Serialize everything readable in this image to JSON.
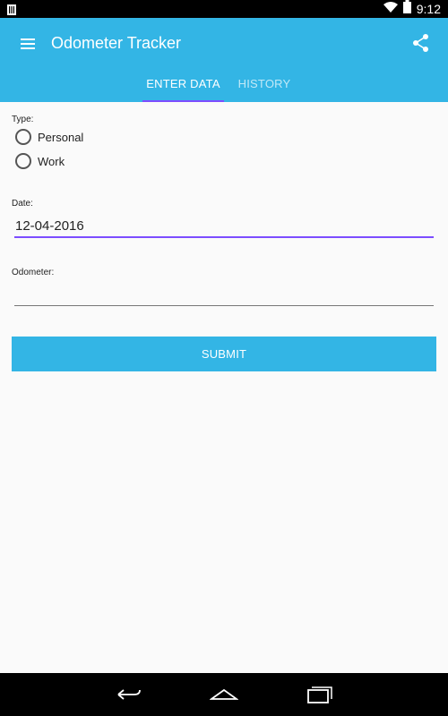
{
  "status_bar": {
    "time": "9:12",
    "icons": [
      "notification-icon",
      "wifi-icon",
      "battery-icon"
    ]
  },
  "app_bar": {
    "title": "Odometer Tracker",
    "menu_icon": "menu-icon",
    "share_icon": "share-icon",
    "background_color": "#33b5e5"
  },
  "tabs": [
    {
      "label": "ENTER DATA",
      "selected": true
    },
    {
      "label": "HISTORY",
      "selected": false
    }
  ],
  "form": {
    "type_label": "Type:",
    "type_options": [
      {
        "label": "Personal",
        "checked": false
      },
      {
        "label": "Work",
        "checked": false
      }
    ],
    "date_label": "Date:",
    "date_value": "12-04-2016",
    "odometer_label": "Odometer:",
    "odometer_value": "",
    "submit_label": "SUBMIT"
  },
  "colors": {
    "accent": "#7c4dff",
    "primary": "#33b5e5"
  },
  "nav_bar": {
    "icons": [
      "back-icon",
      "home-icon",
      "recents-icon"
    ]
  }
}
